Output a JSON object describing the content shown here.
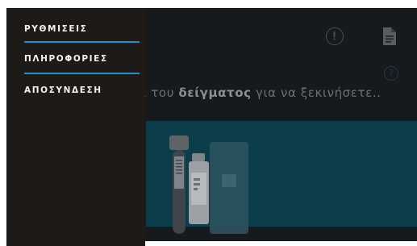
{
  "drawer": {
    "items": [
      {
        "label": "ΡΥΘΜΙΣΕΙΣ"
      },
      {
        "label": "ΠΛΗΡΟΦΟΡΙΕΣ"
      },
      {
        "label": "ΑΠΟΣΥΝΔΕΣΗ"
      }
    ],
    "divider_color": "#1b8fd0"
  },
  "main": {
    "instruction_prefix": "κα του ",
    "instruction_bold": "δείγματος",
    "instruction_suffix": " για να ξεκινήσετε..",
    "icons": [
      "alert-circle-icon",
      "document-icon",
      "help-icon"
    ],
    "help_glyph": "?",
    "panel_color": "#0b3e4a"
  }
}
